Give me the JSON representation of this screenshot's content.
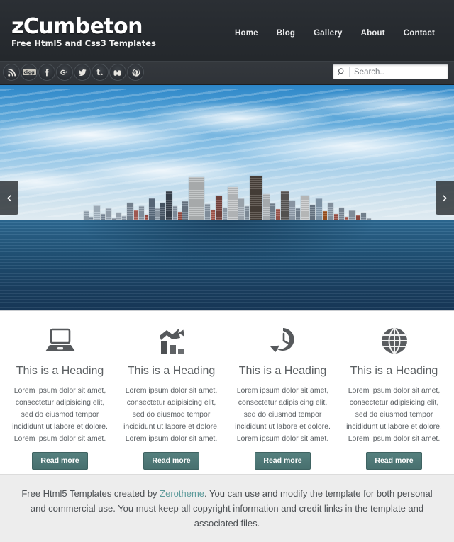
{
  "brand": {
    "title": "zCumbeton",
    "tagline": "Free Html5 and Css3 Templates"
  },
  "nav": {
    "items": [
      {
        "label": "Home"
      },
      {
        "label": "Blog"
      },
      {
        "label": "Gallery"
      },
      {
        "label": "About"
      },
      {
        "label": "Contact"
      }
    ]
  },
  "social": {
    "items": [
      {
        "name": "rss-icon",
        "glyph": ""
      },
      {
        "name": "digg-icon",
        "glyph": "digg"
      },
      {
        "name": "facebook-icon",
        "glyph": "f"
      },
      {
        "name": "google-plus-icon",
        "glyph": "g+"
      },
      {
        "name": "twitter-icon",
        "glyph": ""
      },
      {
        "name": "tumblr-icon",
        "glyph": "t."
      },
      {
        "name": "stumbleupon-icon",
        "glyph": "su"
      },
      {
        "name": "pinterest-icon",
        "glyph": "p"
      }
    ]
  },
  "search": {
    "placeholder": "Search..",
    "value": "",
    "icon": "search-icon"
  },
  "slider": {
    "prev_label": "‹",
    "next_label": "›",
    "image_alt": "Manhattan skyline panorama over water"
  },
  "features": [
    {
      "icon": "laptop-icon",
      "title": "This is a Heading",
      "text": "Lorem ipsum dolor sit amet, consectetur adipisicing elit, sed do eiusmod tempor incididunt ut labore et dolore. Lorem ipsum dolor sit amet.",
      "button": "Read more"
    },
    {
      "icon": "bar-chart-growth-icon",
      "title": "This is a Heading",
      "text": "Lorem ipsum dolor sit amet, consectetur adipisicing elit, sed do eiusmod tempor incididunt ut labore et dolore. Lorem ipsum dolor sit amet.",
      "button": "Read more"
    },
    {
      "icon": "clock-history-icon",
      "title": "This is a Heading",
      "text": "Lorem ipsum dolor sit amet, consectetur adipisicing elit, sed do eiusmod tempor incididunt ut labore et dolore. Lorem ipsum dolor sit amet.",
      "button": "Read more"
    },
    {
      "icon": "globe-icon",
      "title": "This is a Heading",
      "text": "Lorem ipsum dolor sit amet, consectetur adipisicing elit, sed do eiusmod tempor incididunt ut labore et dolore. Lorem ipsum dolor sit amet.",
      "button": "Read more"
    }
  ],
  "footer": {
    "prefix": "Free Html5 Templates created by ",
    "link": "Zerotheme",
    "suffix": ". You can use and modify the template for both personal and commercial use. You must keep all copyright information and credit links in the template and associated files."
  },
  "colors": {
    "header_bg": "#272b30",
    "subbar_bg": "#32373c",
    "accent_teal": "#4e7877",
    "link_teal": "#5d9b9b",
    "footer_bg": "#ededed",
    "icon_gray": "#56595c",
    "body_text": "#5a5f63"
  }
}
